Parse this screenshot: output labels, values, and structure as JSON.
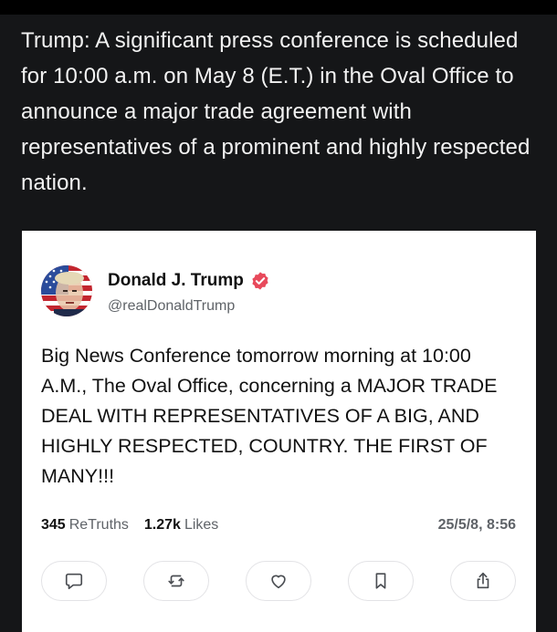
{
  "caption": "Trump: A significant press conference is scheduled for 10:00 a.m. on May 8 (E.T.) in the Oval Office to announce a major trade agreement with representatives of a prominent and highly respected nation.",
  "post": {
    "author_name": "Donald J. Trump",
    "handle": "@realDonaldTrump",
    "verified_icon": "verified-badge-icon",
    "avatar": "avatar-flag-portrait",
    "text": "Big News Conference tomorrow morning at 10:00 A.M., The Oval Office, concerning a MAJOR TRADE DEAL WITH REPRESENTATIVES OF A BIG, AND HIGHLY RESPECTED, COUNTRY. THE FIRST OF MANY!!!",
    "retruths_count": "345",
    "retruths_label": "ReTruths",
    "likes_count": "1.27k",
    "likes_label": "Likes",
    "timestamp": "25/5/8, 8:56"
  },
  "actions": [
    {
      "name": "reply",
      "icon": "comment-icon"
    },
    {
      "name": "retruth",
      "icon": "repost-icon"
    },
    {
      "name": "like",
      "icon": "heart-icon"
    },
    {
      "name": "bookmark",
      "icon": "bookmark-icon"
    },
    {
      "name": "share",
      "icon": "share-icon"
    }
  ],
  "colors": {
    "background": "#151618",
    "card": "#ffffff",
    "verified": "#e8495b",
    "muted_text": "#5f6368"
  }
}
